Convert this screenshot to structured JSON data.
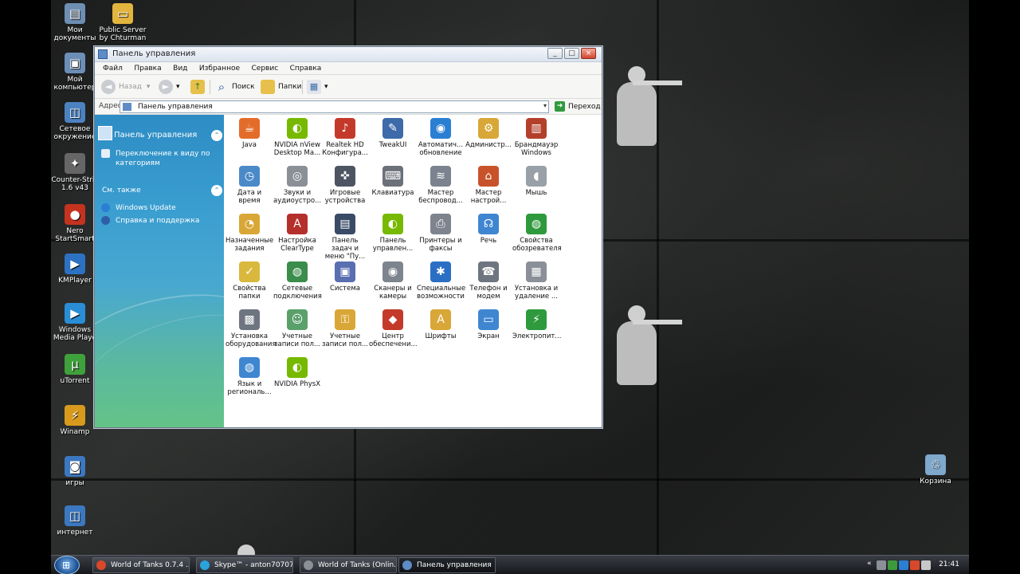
{
  "desktop": {
    "icons": [
      {
        "label": "Мои документы",
        "glyph": "▤",
        "color": "#6e8fb3",
        "icon": "documents-icon"
      },
      {
        "label": "Public Server by Chturman",
        "glyph": "▭",
        "color": "#e2b53e",
        "icon": "folder-icon"
      },
      {
        "label": "Мой компьютер",
        "glyph": "▣",
        "color": "#6c8fb8",
        "icon": "computer-icon"
      },
      {
        "label": "Сетевое окружение",
        "glyph": "◫",
        "color": "#4c82c0",
        "icon": "network-icon"
      },
      {
        "label": "Counter-Strik 1.6 v43",
        "glyph": "✦",
        "color": "#666",
        "icon": "counter-strike-icon"
      },
      {
        "label": "Nero StartSmart",
        "glyph": "●",
        "color": "#c5331f",
        "icon": "nero-icon"
      },
      {
        "label": "KMPlayer",
        "glyph": "▶",
        "color": "#2d72c2",
        "icon": "kmplayer-icon"
      },
      {
        "label": "Windows Media Playe",
        "glyph": "▶",
        "color": "#2a8ed6",
        "icon": "media-player-icon"
      },
      {
        "label": "uTorrent",
        "glyph": "µ",
        "color": "#3fa13c",
        "icon": "utorrent-icon"
      },
      {
        "label": "Winamp",
        "glyph": "⚡",
        "color": "#d89a1d",
        "icon": "winamp-icon"
      },
      {
        "label": "игры",
        "glyph": "◙",
        "color": "#3c78c0",
        "icon": "games-folder-icon"
      },
      {
        "label": "интернет",
        "glyph": "◫",
        "color": "#3c78c0",
        "icon": "internet-folder-icon"
      }
    ],
    "recycle_bin": {
      "label": "Корзина",
      "glyph": "♲",
      "color": "#7ea8cc",
      "icon": "recycle-bin-icon"
    }
  },
  "window": {
    "title": "Панель управления",
    "controls": {
      "minimize": "_",
      "maximize": "□",
      "close": "×"
    },
    "menu": [
      "Файл",
      "Правка",
      "Вид",
      "Избранное",
      "Сервис",
      "Справка"
    ],
    "toolbar": {
      "back": "Назад",
      "back_glyph": "◄",
      "forward_glyph": "►",
      "up_glyph": "↑",
      "search": "Поиск",
      "search_glyph": "⌕",
      "folders": "Папки",
      "views_glyph": "▦",
      "dropdown_glyph": "▾"
    },
    "address": {
      "label": "Адрес:",
      "value": "Панель управления",
      "go": "Переход",
      "go_glyph": "➜",
      "dropdown_glyph": "▾"
    },
    "taskpane": {
      "title": "Панель управления",
      "collapse_glyph": "⌃",
      "switch_view": "Переключение к виду по категориям",
      "see_also": "См. также",
      "links": [
        "Windows Update",
        "Справка и поддержка"
      ]
    },
    "items": [
      {
        "label": "Java",
        "glyph": "☕",
        "color": "#e46c2b",
        "icon": "java-icon"
      },
      {
        "label": "NVIDIA nView Desktop Ma...",
        "glyph": "◐",
        "color": "#76b900",
        "icon": "nvidia-icon"
      },
      {
        "label": "Realtek HD Конфигура...",
        "glyph": "♪",
        "color": "#c43a2a",
        "icon": "speaker-icon"
      },
      {
        "label": "TweakUI",
        "glyph": "✎",
        "color": "#3d6aa8",
        "icon": "tweakui-icon"
      },
      {
        "label": "Автоматич... обновление",
        "glyph": "◉",
        "color": "#2b7fd3",
        "icon": "windows-update-icon"
      },
      {
        "label": "Администр...",
        "glyph": "⚙",
        "color": "#d9a737",
        "icon": "admin-tools-icon"
      },
      {
        "label": "Брандмауэр Windows",
        "glyph": "▥",
        "color": "#b3402b",
        "icon": "firewall-icon"
      },
      {
        "label": "Дата и время",
        "glyph": "◷",
        "color": "#4b8ac8",
        "icon": "datetime-icon"
      },
      {
        "label": "Звуки и аудиоустро...",
        "glyph": "◎",
        "color": "#8a8f98",
        "icon": "sounds-icon"
      },
      {
        "label": "Игровые устройства",
        "glyph": "✜",
        "color": "#4d5563",
        "icon": "gamepad-icon"
      },
      {
        "label": "Клавиатура",
        "glyph": "⌨",
        "color": "#6b7079",
        "icon": "keyboard-icon"
      },
      {
        "label": "Мастер беспровод...",
        "glyph": "≋",
        "color": "#7a838f",
        "icon": "wireless-icon"
      },
      {
        "label": "Мастер настрой...",
        "glyph": "⌂",
        "color": "#c8532b",
        "icon": "network-setup-icon"
      },
      {
        "label": "Мышь",
        "glyph": "◖",
        "color": "#9aa0a8",
        "icon": "mouse-icon"
      },
      {
        "label": "Назначенные задания",
        "glyph": "◔",
        "color": "#d9a737",
        "icon": "scheduled-tasks-icon"
      },
      {
        "label": "Настройка ClearType",
        "glyph": "A",
        "color": "#b5302a",
        "icon": "cleartype-icon"
      },
      {
        "label": "Панель задач и меню \"Пу...",
        "glyph": "▤",
        "color": "#3a4b66",
        "icon": "taskbar-icon"
      },
      {
        "label": "Панель управлен...",
        "glyph": "◐",
        "color": "#76b900",
        "icon": "nvidia-panel-icon"
      },
      {
        "label": "Принтеры и факсы",
        "glyph": "⎙",
        "color": "#7d848e",
        "icon": "printers-icon"
      },
      {
        "label": "Речь",
        "glyph": "☊",
        "color": "#3f86d1",
        "icon": "speech-icon"
      },
      {
        "label": "Свойства обозревателя",
        "glyph": "◍",
        "color": "#2f9a3d",
        "icon": "internet-options-icon"
      },
      {
        "label": "Свойства папки",
        "glyph": "✓",
        "color": "#d9b83d",
        "icon": "folder-options-icon"
      },
      {
        "label": "Сетевые подключения",
        "glyph": "◍",
        "color": "#3a8d4a",
        "icon": "network-connections-icon"
      },
      {
        "label": "Система",
        "glyph": "▣",
        "color": "#5a6fb0",
        "icon": "system-icon"
      },
      {
        "label": "Сканеры и камеры",
        "glyph": "◉",
        "color": "#7d848e",
        "icon": "scanners-icon"
      },
      {
        "label": "Специальные возможности",
        "glyph": "✱",
        "color": "#2b6fc4",
        "icon": "accessibility-icon"
      },
      {
        "label": "Телефон и модем",
        "glyph": "☎",
        "color": "#6e7580",
        "icon": "phone-modem-icon"
      },
      {
        "label": "Установка и удаление ...",
        "glyph": "▦",
        "color": "#8a8f98",
        "icon": "add-remove-icon"
      },
      {
        "label": "Установка оборудования",
        "glyph": "▩",
        "color": "#6e7580",
        "icon": "hardware-icon"
      },
      {
        "label": "Учетные записи пол...",
        "glyph": "☺",
        "color": "#5aa06a",
        "icon": "user-accounts-icon"
      },
      {
        "label": "Учетные записи пол...",
        "glyph": "⚿",
        "color": "#d9a737",
        "icon": "user-accounts-lock-icon"
      },
      {
        "label": "Центр обеспечени...",
        "glyph": "◆",
        "color": "#c43a2a",
        "icon": "security-center-icon"
      },
      {
        "label": "Шрифты",
        "glyph": "A",
        "color": "#d9a737",
        "icon": "fonts-icon"
      },
      {
        "label": "Экран",
        "glyph": "▭",
        "color": "#3f86d1",
        "icon": "display-icon"
      },
      {
        "label": "Электропит...",
        "glyph": "⚡",
        "color": "#2f9a3d",
        "icon": "power-icon"
      },
      {
        "label": "Язык и региональ...",
        "glyph": "◍",
        "color": "#3f86d1",
        "icon": "regional-icon"
      },
      {
        "label": "NVIDIA PhysX",
        "glyph": "◐",
        "color": "#76b900",
        "icon": "physx-icon"
      }
    ]
  },
  "taskbar": {
    "start_glyph": "⊞",
    "tasks": [
      {
        "label": "World of Tanks 0.7.4 ...",
        "color": "#d9482b",
        "icon": "chrome-icon"
      },
      {
        "label": "Skype™ - anton707070",
        "color": "#2aa2dc",
        "icon": "skype-icon"
      },
      {
        "label": "World of Tanks (Onlin...",
        "color": "#8a8f98",
        "icon": "world-of-tanks-icon"
      },
      {
        "label": "Панель управления",
        "color": "#5f8cc7",
        "icon": "control-panel-icon",
        "active": true
      }
    ],
    "tray_arrow": "«",
    "clock": "21:41",
    "tray_icons": [
      "#8a8f98",
      "#3c9a3c",
      "#2b7fd3",
      "#d9482b",
      "#c8c8c8"
    ]
  }
}
